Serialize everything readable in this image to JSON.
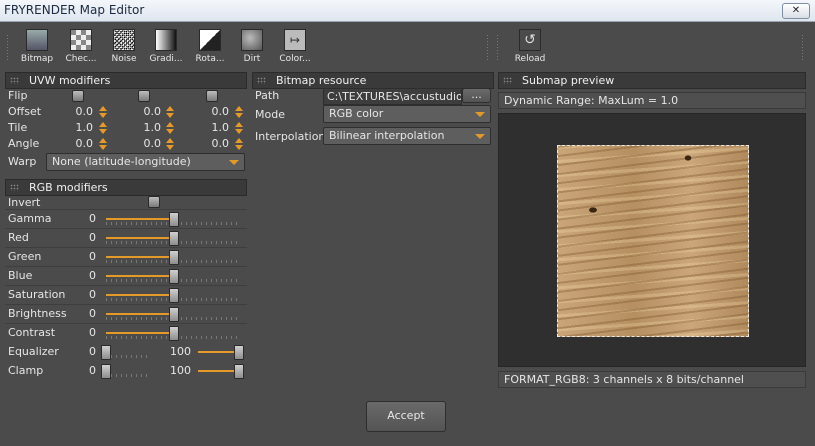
{
  "window": {
    "title": "FRYRENDER Map Editor",
    "close_label": "✕"
  },
  "toolbar": {
    "tools": [
      {
        "label": "Bitmap",
        "icon": "bitmap-icon"
      },
      {
        "label": "Chec...",
        "icon": "checker-icon"
      },
      {
        "label": "Noise",
        "icon": "noise-icon"
      },
      {
        "label": "Gradi...",
        "icon": "gradient-icon"
      },
      {
        "label": "Rota...",
        "icon": "rotation-icon"
      },
      {
        "label": "Dirt",
        "icon": "dirt-icon"
      },
      {
        "label": "Color...",
        "icon": "color-icon"
      }
    ],
    "reload_label": "Reload"
  },
  "uvw": {
    "title": "UVW modifiers",
    "flip_label": "Flip",
    "offset_label": "Offset",
    "offset": [
      "0.0",
      "0.0",
      "0.0"
    ],
    "tile_label": "Tile",
    "tile": [
      "1.0",
      "1.0",
      "1.0"
    ],
    "angle_label": "Angle",
    "angle": [
      "0.0",
      "0.0",
      "0.0"
    ],
    "warp_label": "Warp",
    "warp_value": "None (latitude-longitude)"
  },
  "rgb": {
    "title": "RGB modifiers",
    "invert_label": "Invert",
    "sliders": [
      {
        "label": "Gamma",
        "value": "0",
        "level": 0.5
      },
      {
        "label": "Red",
        "value": "0",
        "level": 0.5
      },
      {
        "label": "Green",
        "value": "0",
        "level": 0.5
      },
      {
        "label": "Blue",
        "value": "0",
        "level": 0.5
      },
      {
        "label": "Saturation",
        "value": "0",
        "level": 0.5
      },
      {
        "label": "Brightness",
        "value": "0",
        "level": 0.5
      },
      {
        "label": "Contrast",
        "value": "0",
        "level": 0.5
      }
    ],
    "equalizer": {
      "label": "Equalizer",
      "min": "0",
      "max": "100"
    },
    "clamp": {
      "label": "Clamp",
      "min": "0",
      "max": "100"
    }
  },
  "bitmap": {
    "title": "Bitmap resource",
    "path_label": "Path",
    "path_value": "C:\\TEXTURES\\accustudio\\W",
    "browse_label": "...",
    "mode_label": "Mode",
    "mode_value": "RGB color",
    "interp_label": "Interpolation",
    "interp_value": "Bilinear interpolation"
  },
  "preview": {
    "title": "Submap preview",
    "dynamic_range": "Dynamic Range:  MaxLum = 1.0",
    "format": "FORMAT_RGB8:  3 channels  x  8 bits/channel"
  },
  "accept_label": "Accept",
  "colors": {
    "accent": "#e49a2a",
    "background": "#4b4b4b",
    "panel_header": "#3a3a3a"
  }
}
